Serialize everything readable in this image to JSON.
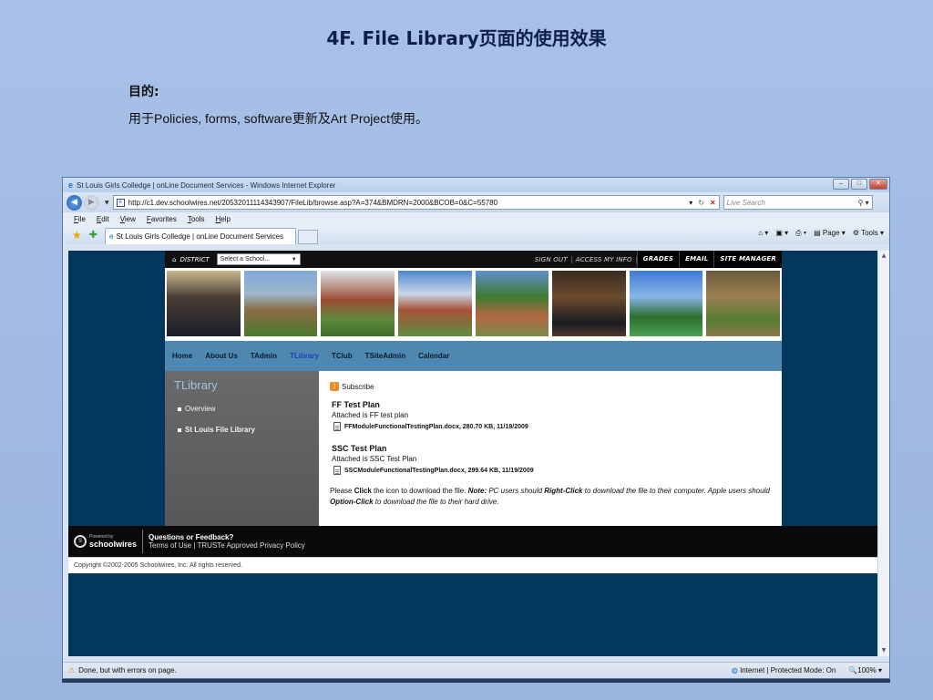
{
  "slide": {
    "title": "4F. File Library页面的使用效果",
    "purpose_label": "目的:",
    "purpose_text": "用于Policies, forms, software更新及Art Project使用。"
  },
  "browser": {
    "window_title": "St Louis Girls Colledge | onLine Document Services - Windows Internet Explorer",
    "address": "http://c1.dev.schoolwires.net/20532011114343907/FileLib/browse.asp?A=374&BMDRN=2000&BCOB=0&C=55780",
    "search_placeholder": "Live Search",
    "menu": [
      "File",
      "Edit",
      "View",
      "Favorites",
      "Tools",
      "Help"
    ],
    "tab_title": "St Louis Girls Colledge | onLine Document Services",
    "cmd": {
      "page": "Page",
      "tools": "Tools"
    },
    "status_text": "Done, but with errors on page.",
    "zone": "Internet | Protected Mode: On",
    "zoom": "100%"
  },
  "site": {
    "district": "DISTRICT",
    "school_select": "Select a School...",
    "top_links": [
      "SIGN OUT",
      "ACCESS MY INFO"
    ],
    "top_links_dark": [
      "GRADES",
      "EMAIL",
      "SITE MANAGER"
    ],
    "nav": [
      "Home",
      "About Us",
      "TAdmin",
      "TLibrary",
      "TClub",
      "TSiteAdmin",
      "Calendar"
    ],
    "nav_active": "TLibrary",
    "sidebar": {
      "title": "TLibrary",
      "items": [
        "Overview",
        "St Louis File Library"
      ]
    },
    "subscribe": "Subscribe",
    "entries": [
      {
        "title": "FF Test Plan",
        "desc": "Attached is FF test plan",
        "file": "FFModuleFunctionalTestingPlan.docx, 280.70 KB, 11/19/2009"
      },
      {
        "title": "SSC Test Plan",
        "desc": "Attached is SSC Test Plan",
        "file": "SSCModuleFunctionalTestingPlan.docx, 299.64 KB, 11/19/2009"
      }
    ],
    "note": {
      "p1": "Please ",
      "click": "Click",
      "p2": " the icon to download the file. ",
      "note_label": "Note:",
      "p3": " PC users should ",
      "right_click": "Right-Click",
      "p4": " to download the file to their computer. Apple users should ",
      "option_click": "Option-Click",
      "p5": " to download the file to their hard drive."
    },
    "footer": {
      "powered": "Powered by",
      "brand": "schoolwires",
      "question": "Questions or Feedback?",
      "links": "Terms of Use | TRUSTe Approved Privacy Policy",
      "copyright": "Copyright ©2002-2005 Schoolwires, Inc. All rights reserved."
    }
  }
}
